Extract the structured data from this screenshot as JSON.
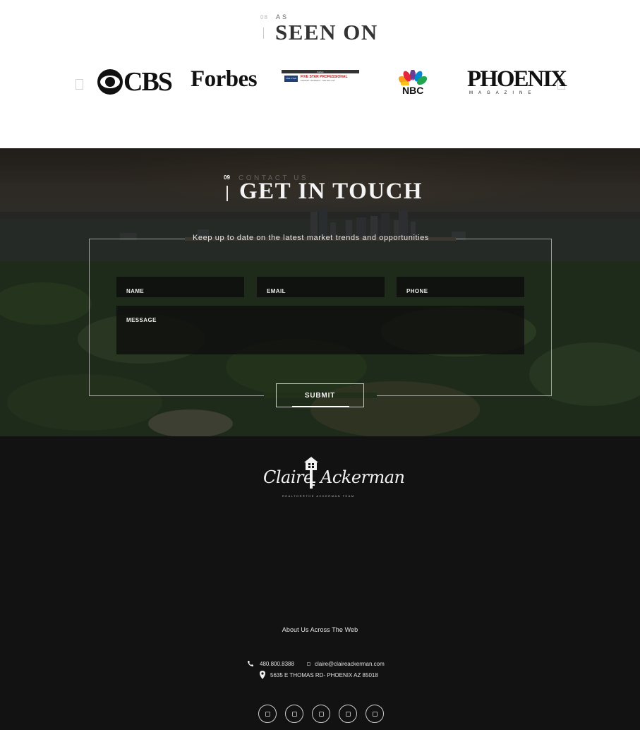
{
  "seen_on": {
    "number": "08",
    "kicker": "AS",
    "title": "SEEN ON",
    "prev_arrow": "",
    "next_arrow": "",
    "logos": {
      "cbs": "CBS",
      "forbes": "Forbes",
      "five_star": {
        "top": "Forbes",
        "badge": "FIVE STAR",
        "title": "FIVE STAR PROFESSIONAL",
        "subtitle": "MARKET LEADERS • THE 500 LIST"
      },
      "nbc": "NBC",
      "phoenix": {
        "name": "PHOENIX",
        "sub": "MAGAZINE"
      }
    }
  },
  "contact": {
    "number": "09",
    "kicker": "CONTACT US",
    "title": "GET IN TOUCH",
    "intro": "Keep up to date on the latest market trends and opportunities",
    "fields": {
      "name": "NAME",
      "email": "EMAIL",
      "phone": "PHONE",
      "message": "MESSAGE"
    },
    "submit": "SUBMIT"
  },
  "footer": {
    "logo": {
      "first": "Claire",
      "last": "Ackerman",
      "tagline": "REALTOR®THE ACKERMAN TEAM"
    },
    "about": "About Us Across The Web",
    "phone": "480.800.8388",
    "email": "claire@claireackerman.com",
    "address": "5635 E THOMAS RD- PHOENIX AZ 85018",
    "socials": [
      "social-icon",
      "social-icon",
      "social-icon",
      "social-icon",
      "social-icon"
    ]
  }
}
